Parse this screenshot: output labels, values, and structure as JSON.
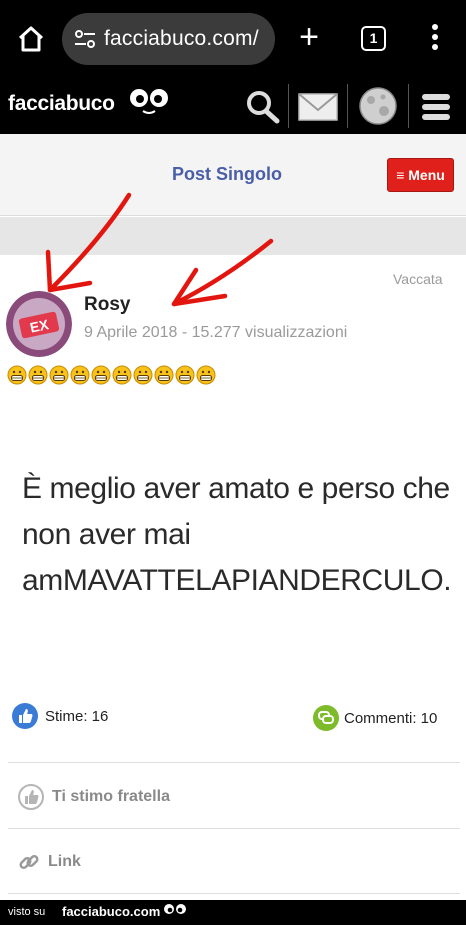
{
  "browser": {
    "url": "facciabuco.com/",
    "tab_count": "1",
    "new_tab_label": "+"
  },
  "site": {
    "logo": "facciabuco",
    "icons": [
      "search-icon",
      "mail-icon",
      "moon-avatar-icon",
      "hamburger-icon"
    ]
  },
  "title_bar": {
    "title": "Post Singolo",
    "menu_label": "≡ Menu"
  },
  "post": {
    "category": "Vaccata",
    "author": "Rosy",
    "meta": "9 Aprile 2018 - 15.277 visualizzazioni",
    "emoji_count": 10,
    "image_text": [
      "È meglio aver amato e perso che",
      "non aver mai",
      "amMAVATTELAPIANDERCULO."
    ],
    "likes_label": "Stime: 16",
    "comments_label": "Commenti: 10",
    "actions": {
      "like": "Ti stimo fratella",
      "link": "Link"
    }
  },
  "footer": {
    "prefix": "visto su",
    "site": "facciabuco.com"
  },
  "colors": {
    "accent_blue": "#4a5ea8",
    "menu_red": "#e0201b",
    "arrow_red": "#e3160f"
  }
}
